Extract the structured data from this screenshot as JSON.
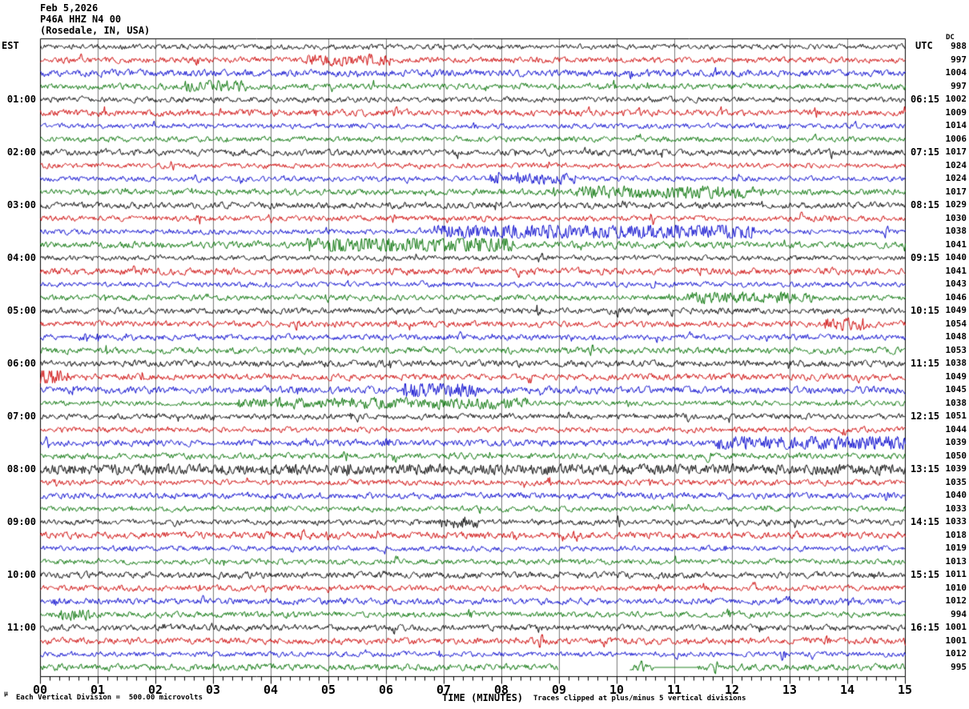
{
  "header": {
    "date": "Feb 5,2026",
    "station": "P46A HHZ N4 00",
    "location": "(Rosedale, IN, USA)"
  },
  "left_axis": {
    "tz": "EST"
  },
  "right_axis": {
    "tz": "UTC",
    "dc_label": "DC"
  },
  "x_axis": {
    "title": "TIME (MINUTES)",
    "tick_labels": [
      "00",
      "01",
      "02",
      "03",
      "04",
      "05",
      "06",
      "07",
      "08",
      "09",
      "10",
      "11",
      "12",
      "13",
      "14",
      "15"
    ]
  },
  "footer": {
    "micro_mark": "µ",
    "division_note": "Each Vertical Division =  500.00 microvolts",
    "clip_note": "Traces clipped at plus/minus 5 vertical divisions"
  },
  "colors": {
    "trace_cycle": [
      "#000000",
      "#cc0000",
      "#0000cc",
      "#007000"
    ],
    "grid": "#7a7a7a",
    "border": "#000000",
    "text": "#000000"
  },
  "chart_data": {
    "type": "line",
    "subtype": "helicorder-seismogram",
    "title": "P46A HHZ N4 00 (Rosedale, IN, USA) Feb 5,2026",
    "xlabel": "TIME (MINUTES)",
    "x_range_minutes": [
      0,
      15
    ],
    "trace_count": 48,
    "minutes_per_trace": 15,
    "rows_per_hour": 4,
    "trace_color_cycle": [
      "#000000",
      "#cc0000",
      "#0000cc",
      "#007000"
    ],
    "est_start_times": [
      "01:00",
      "02:00",
      "03:00",
      "04:00",
      "05:00",
      "06:00",
      "07:00",
      "08:00",
      "09:00",
      "10:00",
      "11:00"
    ],
    "utc_start_times": [
      "06:15",
      "07:15",
      "08:15",
      "09:15",
      "10:15",
      "11:15",
      "12:15",
      "13:15",
      "14:15",
      "15:15",
      "16:15"
    ],
    "hour_label_first_row": 5,
    "dc_offsets": [
      988,
      997,
      1004,
      997,
      1002,
      1009,
      1014,
      1006,
      1017,
      1024,
      1024,
      1017,
      1029,
      1030,
      1038,
      1041,
      1040,
      1041,
      1043,
      1046,
      1049,
      1054,
      1048,
      1053,
      1038,
      1049,
      1045,
      1038,
      1051,
      1044,
      1039,
      1050,
      1039,
      1035,
      1040,
      1033,
      1033,
      1018,
      1019,
      1013,
      1011,
      1010,
      1012,
      994,
      1001,
      1001,
      1012,
      995
    ],
    "volts_per_division": "500.00 microvolts",
    "clip_limit_divisions": 5,
    "content_note": "continuous ambient seismic noise traces; rows cycle black/red/blue/green",
    "events": [
      {
        "row": 2,
        "start": 4.6,
        "end": 6.1,
        "gain": 1.7
      },
      {
        "row": 4,
        "start": 2.5,
        "end": 3.6,
        "gain": 1.8
      },
      {
        "row": 11,
        "start": 7.8,
        "end": 9.3,
        "gain": 1.8
      },
      {
        "row": 12,
        "start": 9.3,
        "end": 12.2,
        "gain": 2.0
      },
      {
        "row": 15,
        "start": 6.8,
        "end": 12.4,
        "gain": 2.5
      },
      {
        "row": 16,
        "start": 4.6,
        "end": 8.2,
        "gain": 2.3
      },
      {
        "row": 20,
        "start": 11.2,
        "end": 13.4,
        "gain": 1.7
      },
      {
        "row": 22,
        "start": 13.6,
        "end": 14.3,
        "gain": 2.2
      },
      {
        "row": 26,
        "start": 0.0,
        "end": 0.5,
        "gain": 2.3
      },
      {
        "row": 27,
        "start": 6.3,
        "end": 7.6,
        "gain": 2.0
      },
      {
        "row": 28,
        "start": 3.4,
        "end": 8.5,
        "gain": 1.9
      },
      {
        "row": 31,
        "start": 11.7,
        "end": 15.0,
        "gain": 2.0
      },
      {
        "row": 33,
        "start": 0.0,
        "end": 15.0,
        "gain": 1.4
      },
      {
        "row": 37,
        "start": 6.9,
        "end": 7.6,
        "gain": 1.9
      },
      {
        "row": 44,
        "start": 0.3,
        "end": 0.9,
        "gain": 1.7
      }
    ],
    "gaps": [
      {
        "row": 48,
        "start": 8.98,
        "end": 10.22
      }
    ],
    "flats": [
      {
        "row": 48,
        "start": 10.65,
        "end": 11.4
      }
    ]
  }
}
